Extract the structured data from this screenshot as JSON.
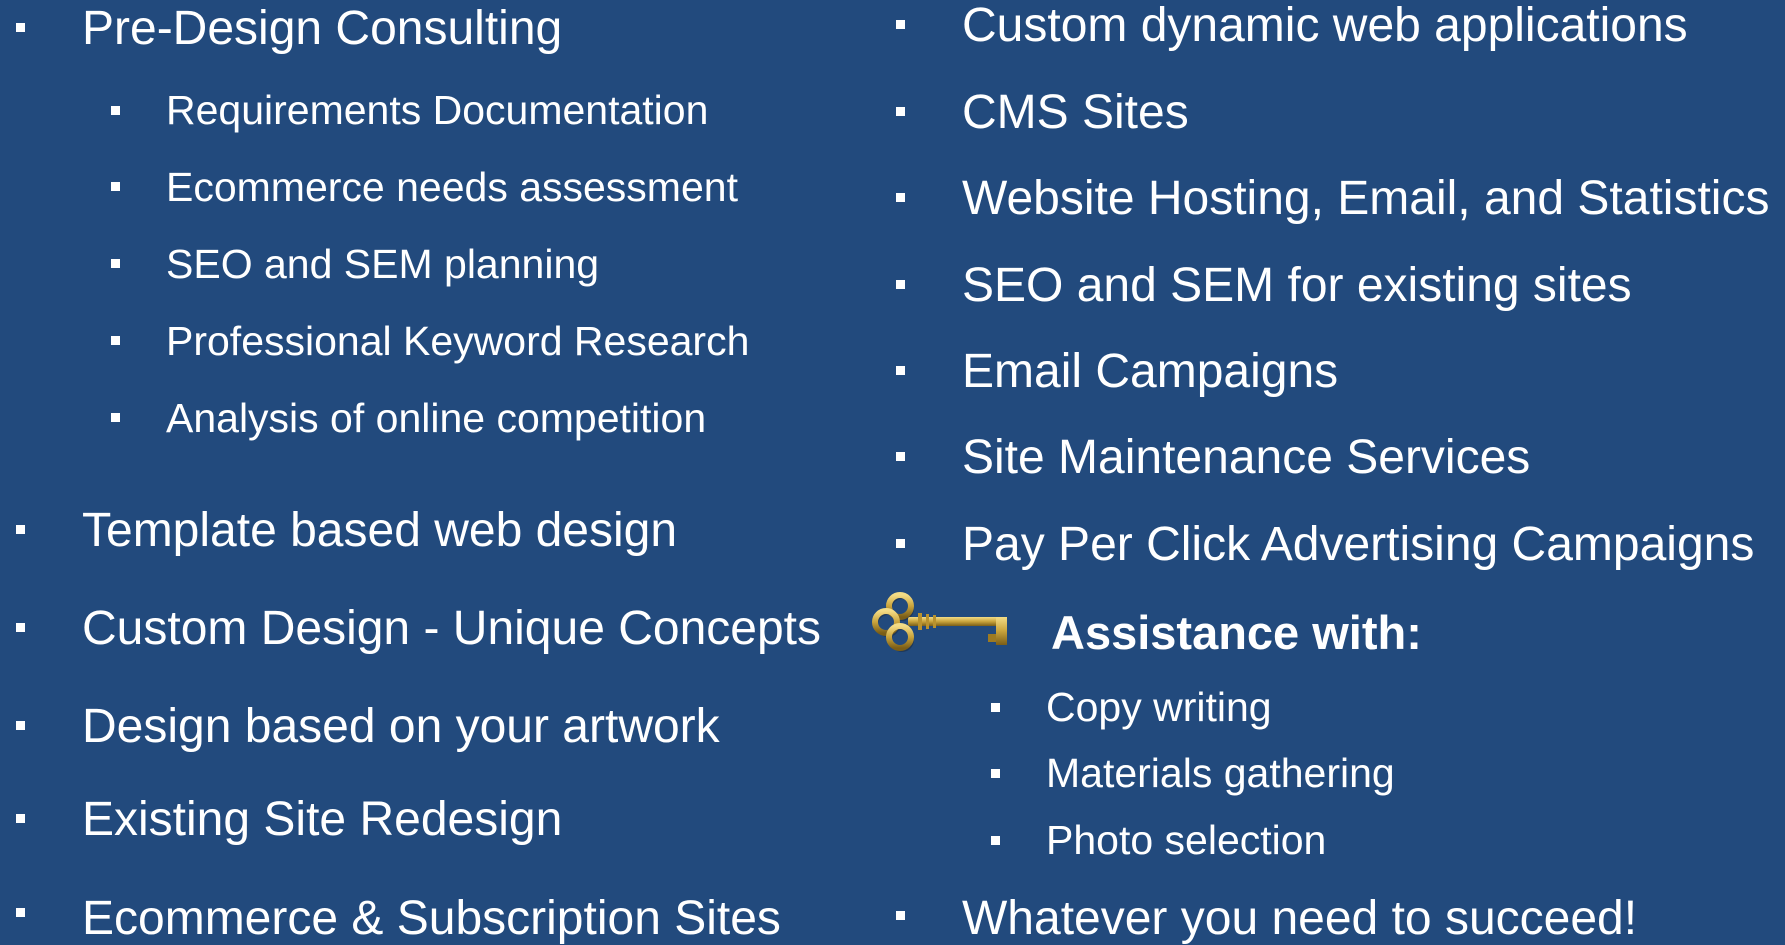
{
  "left_column": {
    "main_items": [
      "Pre-Design Consulting",
      "Template based web design",
      "Custom Design - Unique Concepts",
      "Design based on your artwork",
      "Existing Site Redesign",
      "Ecommerce & Subscription Sites"
    ],
    "sub_items": [
      "Requirements Documentation",
      "Ecommerce needs assessment",
      "SEO and SEM planning",
      "Professional Keyword Research",
      "Analysis of online competition"
    ]
  },
  "right_column": {
    "main_items": [
      "Custom dynamic web applications",
      "CMS Sites",
      "Website Hosting, Email, and Statistics",
      "SEO and SEM for existing sites",
      "Email Campaigns",
      "Site Maintenance Services",
      "Pay Per Click Advertising Campaigns"
    ],
    "assistance_heading": "Assistance with:",
    "assistance_items": [
      "Copy writing",
      "Materials gathering",
      "Photo selection"
    ],
    "closing_item": "Whatever you need to succeed!"
  },
  "icons": {
    "key": "key-icon",
    "bullet": "square-bullet-icon"
  },
  "colors": {
    "background": "#224a7d",
    "text": "#ffffff"
  }
}
